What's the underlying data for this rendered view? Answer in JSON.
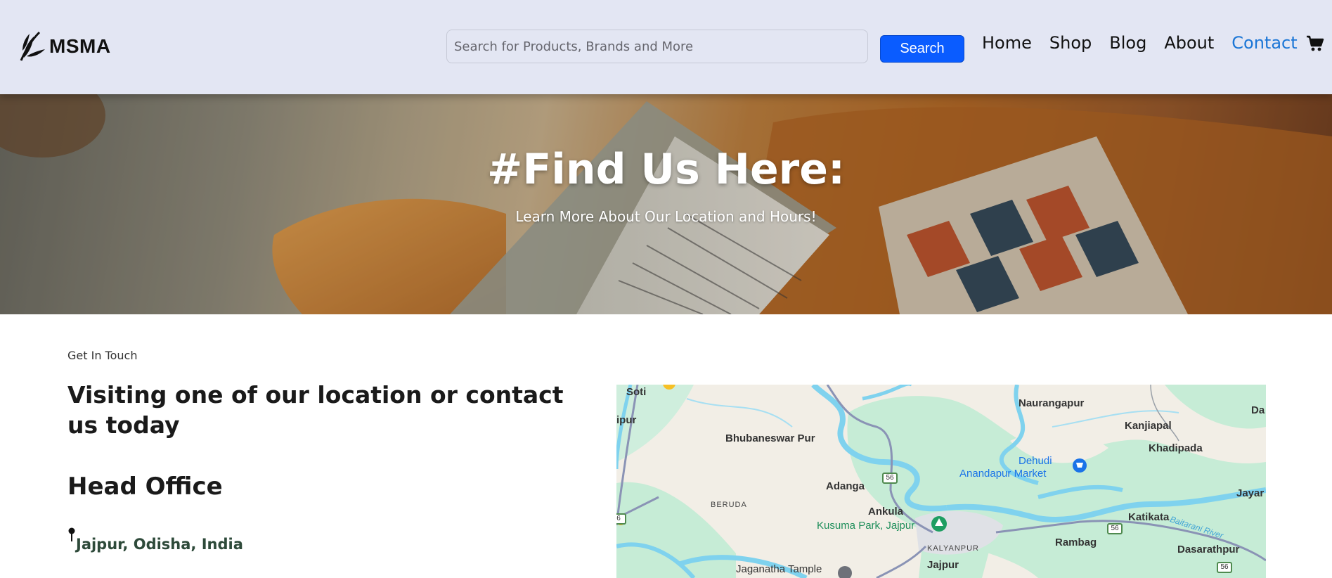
{
  "header": {
    "logo_text": "MSMA",
    "search_placeholder": "Search for Products, Brands and More",
    "search_button": "Search",
    "nav": [
      {
        "label": "Home",
        "active": false
      },
      {
        "label": "Shop",
        "active": false
      },
      {
        "label": "Blog",
        "active": false
      },
      {
        "label": "About",
        "active": false
      },
      {
        "label": "Contact",
        "active": true
      }
    ],
    "cart_icon": "cart-icon"
  },
  "hero": {
    "title": "#Find Us Here:",
    "subtitle": "Learn More About Our Location and Hours!"
  },
  "contact": {
    "eyebrow": "Get In Touch",
    "heading": "Visiting one of our location or contact us today",
    "office_title": "Head Office",
    "location": "Jajpur, Odisha, India",
    "location_icon": "map-pin-icon"
  },
  "map": {
    "places": [
      "Soti",
      "ipur",
      "Bhubaneswar Pur",
      "Naurangapur",
      "Kanjiapal",
      "Da",
      "Khadipada",
      "Dehudi",
      "Anandapur Market",
      "Adanga",
      "BERUDA",
      "Ankula",
      "Kusuma Park, Jajpur",
      "KALYANPUR",
      "Jajpur",
      "Katikata",
      "Rambag",
      "Dasarathpur",
      "Jayar",
      "Baitarani River",
      "Jaganatha Tample"
    ],
    "road_numbers": [
      "56",
      "56",
      "56",
      "6"
    ]
  },
  "colors": {
    "header_bg": "#e3e6f3",
    "accent_blue": "#0a5cff",
    "nav_active": "#1b76d6",
    "location_text": "#2e4a3a"
  }
}
